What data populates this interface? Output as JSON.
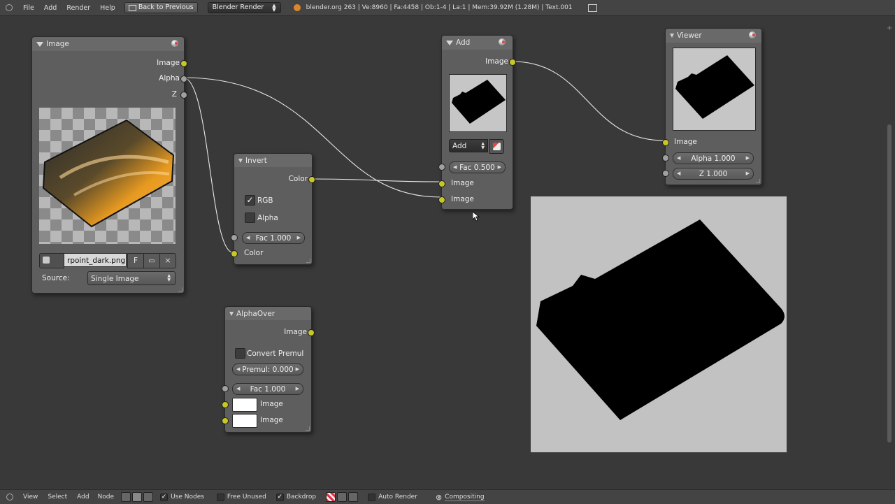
{
  "header": {
    "menus": [
      "File",
      "Add",
      "Render",
      "Help"
    ],
    "back_button": "Back to Previous",
    "render_engine": "Blender Render",
    "stats": "blender.org 263 | Ve:8960 | Fa:4458 | Ob:1-4 | La:1 | Mem:39.92M (1.28M) | Text.001"
  },
  "nodes": {
    "image": {
      "title": "Image",
      "outputs": [
        "Image",
        "Alpha",
        "Z"
      ],
      "file_name": "rpoint_dark.png",
      "fake_user": "F",
      "source_label": "Source:",
      "source_value": "Single Image"
    },
    "invert": {
      "title": "Invert",
      "output": "Color",
      "rgb_label": "RGB",
      "rgb_checked": true,
      "alpha_label": "Alpha",
      "alpha_checked": false,
      "fac": "Fac 1.000",
      "color_input": "Color"
    },
    "add": {
      "title": "Add",
      "output": "Image",
      "blend_mode": "Add",
      "fac": "Fac 0.500",
      "input1": "Image",
      "input2": "Image"
    },
    "viewer": {
      "title": "Viewer",
      "input": "Image",
      "alpha": "Alpha 1.000",
      "z": "Z 1.000"
    },
    "alphaover": {
      "title": "AlphaOver",
      "output": "Image",
      "convert_label": "Convert Premul",
      "premul": "Premul: 0.000",
      "fac": "Fac 1.000",
      "input1": "Image",
      "input2": "Image"
    }
  },
  "footer": {
    "menus": [
      "View",
      "Select",
      "Add",
      "Node"
    ],
    "use_nodes": "Use Nodes",
    "free_unused": "Free Unused",
    "backdrop": "Backdrop",
    "auto_render": "Auto Render",
    "compositing": "Compositing"
  },
  "colors": {
    "socket_yellow": "#c7c729",
    "socket_gray": "#a0a0a0",
    "editor_bg": "#393939",
    "node_bg": "#5e5e5e"
  }
}
